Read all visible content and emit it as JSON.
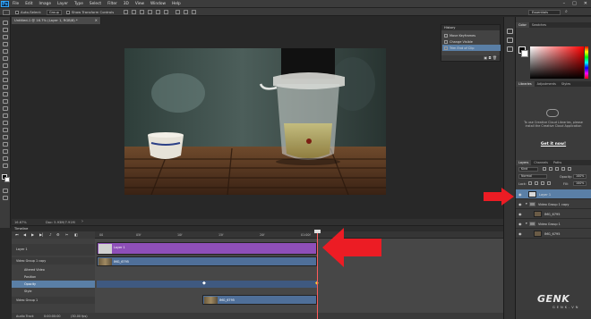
{
  "app": {
    "logo": "Ps"
  },
  "menu": [
    "File",
    "Edit",
    "Image",
    "Layer",
    "Type",
    "Select",
    "Filter",
    "3D",
    "View",
    "Window",
    "Help"
  ],
  "window_controls": [
    "–",
    "□",
    "✕"
  ],
  "options": {
    "auto_select": "Auto-Select:",
    "auto_select_value": "Group",
    "show_transform": "Show Transform Controls",
    "workspace": "Essentials"
  },
  "document": {
    "tab_title": "Untitled-1 @ 16.7% (Layer 1, RGB/8) *",
    "zoom": "16.67%",
    "doc_size": "Doc: 5.93M/7.91M"
  },
  "history": {
    "title": "History",
    "items": [
      "Move Keyframes",
      "Change Visible",
      "Trim End of Clip"
    ],
    "selected_index": 2
  },
  "color_panel": {
    "tabs": [
      "Color",
      "Swatches"
    ]
  },
  "libraries_panel": {
    "tabs": [
      "Libraries",
      "Adjustments",
      "Styles"
    ],
    "message": "To use Creative Cloud Libraries, please install the Creative Cloud Application",
    "link": "Get it now!"
  },
  "layers_panel": {
    "tabs": [
      "Layers",
      "Channels",
      "Paths"
    ],
    "filter_kind": "Kind",
    "blend_mode": "Normal",
    "opacity_label": "Opacity:",
    "opacity_value": "100%",
    "lock_label": "Lock:",
    "fill_label": "Fill:",
    "fill_value": "100%",
    "layers": [
      {
        "name": "Layer 1",
        "type": "pixel",
        "selected": true,
        "indent": 0
      },
      {
        "name": "Video Group 1 copy",
        "type": "group",
        "selected": false,
        "indent": 0
      },
      {
        "name": "IMG_6795",
        "type": "pixel",
        "selected": false,
        "indent": 1
      },
      {
        "name": "Video Group 1",
        "type": "group",
        "selected": false,
        "indent": 0
      },
      {
        "name": "IMG_6795",
        "type": "pixel",
        "selected": false,
        "indent": 1
      }
    ]
  },
  "timeline": {
    "title": "Timeline",
    "ruler_ticks": [
      "00",
      "05f",
      "10f",
      "15f",
      "20f",
      "01:00f"
    ],
    "tracks": [
      {
        "label": "Layer 1",
        "style": "purple-row"
      },
      {
        "label": "Video Group 1 copy",
        "style": "dark"
      },
      {
        "label": "Altered Video",
        "style": "plain"
      },
      {
        "label": "Position",
        "style": "plain"
      },
      {
        "label": "Opacity",
        "style": "sel"
      },
      {
        "label": "Style",
        "style": "plain"
      },
      {
        "label": "Video Group 1",
        "style": "dark"
      }
    ],
    "clips": [
      {
        "label": "Layer 1",
        "color": "#8e4fb8"
      },
      {
        "label": "IMG_6795",
        "color": "#4f6f99"
      },
      {
        "label": "IMG_6795",
        "color": "#4f6f99"
      }
    ],
    "footer": {
      "audio_track": "Audio Track",
      "timecode": "0:00:00:00",
      "fps": "(30.00 fps)"
    }
  },
  "watermark": {
    "brand": "GENK",
    "sub": "GENK.VN"
  },
  "accent_colors": {
    "selection": "#5a7fa6",
    "annotation_arrow": "#ec1c24",
    "clip_purple": "#8e4fb8",
    "clip_blue": "#4f6f99"
  }
}
